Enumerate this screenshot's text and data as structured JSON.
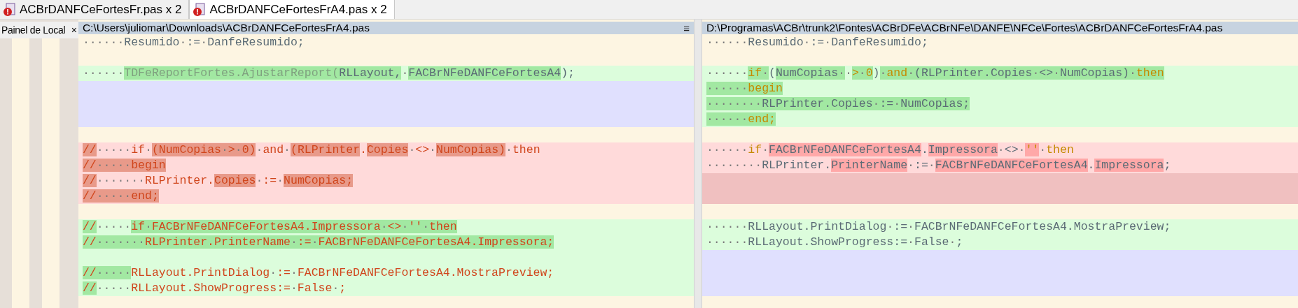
{
  "tabs": [
    {
      "label": "ACBrDANFCeFortesFr.pas x 2",
      "selected": false
    },
    {
      "label": "ACBrDANFCeFortesFrA4.pas x 2",
      "selected": true
    }
  ],
  "side_panel": {
    "title": "Painel de Local",
    "close": "×"
  },
  "left_pane": {
    "path": "C:\\Users\\juliomar\\Downloads\\ACBrDANFCeFortesFrA4.pas",
    "menu": "≡",
    "lines": [
      {
        "kind": "context",
        "segments": [
          {
            "text": "······Resumido·:=·DanfeResumido;",
            "kind": "plain",
            "hl": false
          }
        ]
      },
      {
        "kind": "context"
      },
      {
        "kind": "added",
        "segments": [
          {
            "text": "······",
            "kind": "plain",
            "hl": false
          },
          {
            "text": "TDFeReportFortes.AjustarReport(",
            "kind": "faded",
            "hl": true
          },
          {
            "text": "RLLayout,",
            "kind": "plain",
            "hl": true
          },
          {
            "text": "·",
            "kind": "plain",
            "hl": false
          },
          {
            "text": "FACBrNFeDANFCeFortesA4",
            "kind": "plain",
            "hl": true
          },
          {
            "text": ");",
            "kind": "plain",
            "hl": false
          }
        ]
      },
      {
        "kind": "filler"
      },
      {
        "kind": "filler"
      },
      {
        "kind": "filler"
      },
      {
        "kind": "context"
      },
      {
        "kind": "removed",
        "segments": [
          {
            "text": "//",
            "kind": "comment",
            "hl": true
          },
          {
            "text": "·····if·",
            "kind": "comment",
            "hl": false
          },
          {
            "text": "(NumCopias·>·0)",
            "kind": "comment",
            "hl": true
          },
          {
            "text": "·and·",
            "kind": "comment",
            "hl": false
          },
          {
            "text": "(RLPrinter",
            "kind": "comment",
            "hl": true
          },
          {
            "text": ".",
            "kind": "comment",
            "hl": false
          },
          {
            "text": "Copies",
            "kind": "comment",
            "hl": true
          },
          {
            "text": "·<>·",
            "kind": "comment",
            "hl": false
          },
          {
            "text": "NumCopias)",
            "kind": "comment",
            "hl": true
          },
          {
            "text": "·then",
            "kind": "comment",
            "hl": false
          }
        ]
      },
      {
        "kind": "removed",
        "segments": [
          {
            "text": "//·····begin",
            "kind": "comment",
            "hl": true
          }
        ]
      },
      {
        "kind": "removed",
        "segments": [
          {
            "text": "//",
            "kind": "comment",
            "hl": true
          },
          {
            "text": "·······RLPrinter.",
            "kind": "comment",
            "hl": false
          },
          {
            "text": "Copies",
            "kind": "comment",
            "hl": true
          },
          {
            "text": "·:=·",
            "kind": "comment",
            "hl": false
          },
          {
            "text": "NumCopias;",
            "kind": "comment",
            "hl": true
          }
        ]
      },
      {
        "kind": "removed",
        "segments": [
          {
            "text": "//·····end;",
            "kind": "comment",
            "hl": true
          }
        ]
      },
      {
        "kind": "context"
      },
      {
        "kind": "added",
        "segments": [
          {
            "text": "//",
            "kind": "comment",
            "hl": true
          },
          {
            "text": "·····",
            "kind": "comment",
            "hl": false
          },
          {
            "text": "if·FACBrNFeDANFCeFortesA4.Impressora·<>·''·then",
            "kind": "comment",
            "hl": true
          }
        ]
      },
      {
        "kind": "added",
        "segments": [
          {
            "text": "//·······RLPrinter.PrinterName·:=·FACBrNFeDANFCeFortesA4.Impressora;",
            "kind": "comment",
            "hl": true
          }
        ]
      },
      {
        "kind": "added"
      },
      {
        "kind": "added",
        "segments": [
          {
            "text": "//·····",
            "kind": "comment",
            "hl": true
          },
          {
            "text": "RLLayout.PrintDialog·:=·FACBrNFeDANFCeFortesA4.MostraPreview;",
            "kind": "comment",
            "hl": false
          }
        ]
      },
      {
        "kind": "added",
        "segments": [
          {
            "text": "//",
            "kind": "comment",
            "hl": true
          },
          {
            "text": "·····RLLayout.ShowProgress:=·False·;",
            "kind": "comment",
            "hl": false
          }
        ]
      },
      {
        "kind": "context"
      }
    ]
  },
  "right_pane": {
    "path": "D:\\Programas\\ACBr\\trunk2\\Fontes\\ACBrDFe\\ACBrNFe\\DANFE\\NFCe\\Fortes\\ACBrDANFCeFortesFrA4.pas",
    "lines": [
      {
        "kind": "context",
        "segments": [
          {
            "text": "······Resumido·:=·DanfeResumido;",
            "kind": "plain",
            "hl": false
          }
        ]
      },
      {
        "kind": "context"
      },
      {
        "kind": "added",
        "segments": [
          {
            "text": "······",
            "kind": "plain",
            "hl": false
          },
          {
            "text": "if·",
            "kind": "keyword",
            "hl": true
          },
          {
            "text": "(",
            "kind": "plain",
            "hl": false
          },
          {
            "text": "NumCopias·",
            "kind": "plain",
            "hl": true
          },
          {
            "text": "·",
            "kind": "plain",
            "hl": false
          },
          {
            "text": ">·0",
            "kind": "keyword",
            "hl": true
          },
          {
            "text": ")",
            "kind": "plain",
            "hl": false
          },
          {
            "text": "·and·",
            "kind": "keyword",
            "hl": true
          },
          {
            "text": "(RLPrinter.Copies·<>·NumCopias)·",
            "kind": "plain",
            "hl": true
          },
          {
            "text": "then",
            "kind": "keyword",
            "hl": true
          }
        ]
      },
      {
        "kind": "added",
        "segments": [
          {
            "text": "······begin",
            "kind": "keyword",
            "hl": true
          }
        ]
      },
      {
        "kind": "added",
        "segments": [
          {
            "text": "········RLPrinter.Copies·:=·NumCopias;",
            "kind": "plain",
            "hl": true
          }
        ]
      },
      {
        "kind": "added",
        "segments": [
          {
            "text": "······end;",
            "kind": "keyword",
            "hl": true
          }
        ]
      },
      {
        "kind": "context"
      },
      {
        "kind": "removed",
        "segments": [
          {
            "text": "······",
            "kind": "plain",
            "hl": false
          },
          {
            "text": "if·",
            "kind": "keyword",
            "hl": false
          },
          {
            "text": "FACBrNFeDANFCeFortesA4",
            "kind": "plain",
            "hl": true
          },
          {
            "text": ".",
            "kind": "plain",
            "hl": false
          },
          {
            "text": "Impressora",
            "kind": "plain",
            "hl": true
          },
          {
            "text": "·<>·",
            "kind": "plain",
            "hl": false
          },
          {
            "text": "''",
            "kind": "keyword",
            "hl": true
          },
          {
            "text": "·then",
            "kind": "keyword",
            "hl": false
          }
        ]
      },
      {
        "kind": "removed",
        "segments": [
          {
            "text": "········RLPrinter.",
            "kind": "plain",
            "hl": false
          },
          {
            "text": "PrinterName",
            "kind": "plain",
            "hl": true
          },
          {
            "text": "·:=·",
            "kind": "plain",
            "hl": false
          },
          {
            "text": "FACBrNFeDANFCeFortesA4",
            "kind": "plain",
            "hl": true
          },
          {
            "text": ".",
            "kind": "plain",
            "hl": false
          },
          {
            "text": "Impressora",
            "kind": "plain",
            "hl": true
          },
          {
            "text": ";",
            "kind": "plain",
            "hl": false
          }
        ]
      },
      {
        "kind": "gap"
      },
      {
        "kind": "gap"
      },
      {
        "kind": "context"
      },
      {
        "kind": "added",
        "segments": [
          {
            "text": "······RLLayout.PrintDialog·:=·FACBrNFeDANFCeFortesA4.MostraPreview;",
            "kind": "plain",
            "hl": false
          }
        ]
      },
      {
        "kind": "added",
        "segments": [
          {
            "text": "······RLLayout.ShowProgress:=·False·;",
            "kind": "plain",
            "hl": false
          }
        ]
      },
      {
        "kind": "filler"
      },
      {
        "kind": "filler"
      },
      {
        "kind": "filler"
      },
      {
        "kind": "context"
      }
    ]
  }
}
